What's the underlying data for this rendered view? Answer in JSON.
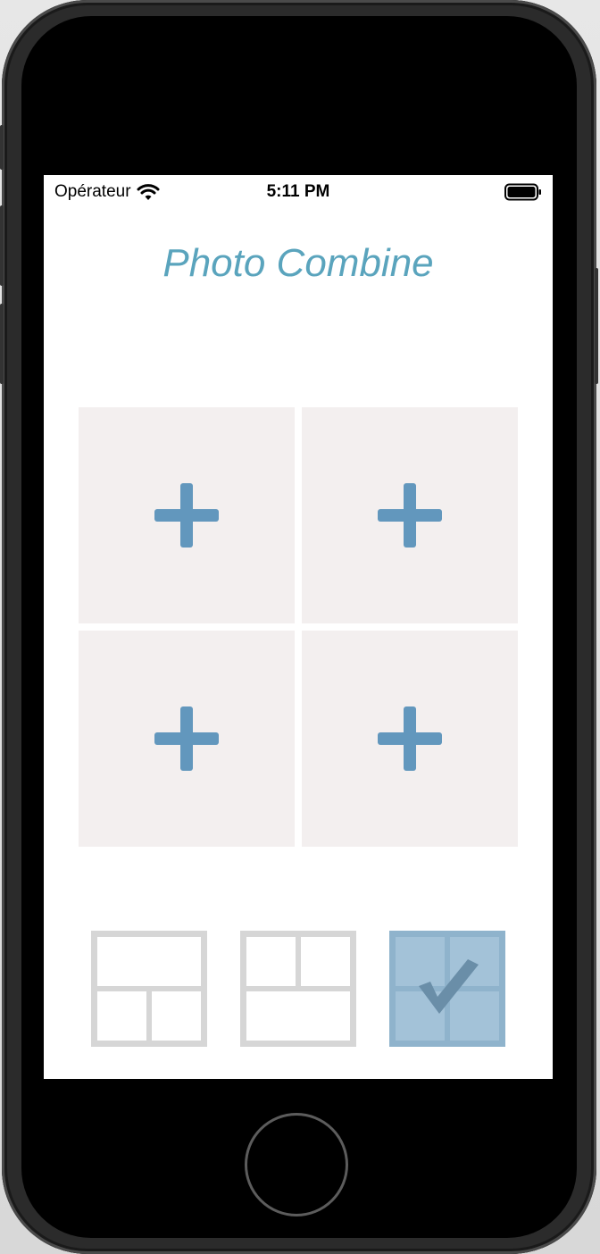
{
  "status_bar": {
    "carrier": "Opérateur",
    "time": "5:11 PM",
    "wifi_icon": "wifi-icon",
    "battery_icon": "battery-icon"
  },
  "app": {
    "title": "Photo Combine"
  },
  "photo_grid": {
    "cells": [
      {
        "icon": "plus-icon"
      },
      {
        "icon": "plus-icon"
      },
      {
        "icon": "plus-icon"
      },
      {
        "icon": "plus-icon"
      }
    ]
  },
  "layouts": [
    {
      "id": "layout-wide-top",
      "selected": false
    },
    {
      "id": "layout-wide-bottom",
      "selected": false
    },
    {
      "id": "layout-four-squares",
      "selected": true,
      "icon": "checkmark-icon"
    }
  ],
  "colors": {
    "accent": "#5aa4bd",
    "plus": "#6297bd",
    "cell_background": "#f3efef",
    "layout_border": "#d6d6d6",
    "layout_selected": "#8fb3cc"
  }
}
